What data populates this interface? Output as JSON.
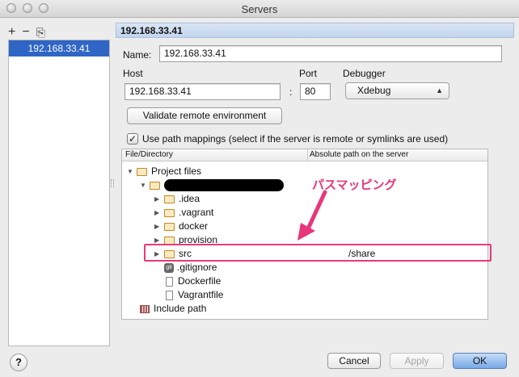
{
  "window": {
    "title": "Servers"
  },
  "left": {
    "toolbar": {
      "add": "+",
      "remove": "−",
      "copy": "⎘"
    },
    "servers": [
      "192.168.33.41"
    ]
  },
  "server": {
    "header": "192.168.33.41",
    "name_label": "Name:",
    "name_value": "192.168.33.41",
    "host_label": "Host",
    "host_value": "192.168.33.41",
    "port_label": "Port",
    "port_sep": ":",
    "port_value": "80",
    "debugger_label": "Debugger",
    "debugger_value": "Xdebug",
    "validate_button": "Validate remote environment",
    "use_path_mappings": "Use path mappings (select if the server is remote or symlinks are used)",
    "use_path_mappings_checked": true
  },
  "tree": {
    "col_file": "File/Directory",
    "col_path": "Absolute path on the server",
    "project_files": "Project files",
    "children": [
      ".idea",
      ".vagrant",
      "docker",
      "provision",
      "src"
    ],
    "src_mapping": "/share",
    "files": [
      ".gitignore",
      "Dockerfile",
      "Vagrantfile"
    ],
    "include_path": "Include path"
  },
  "annotation": {
    "text": "パスマッピング",
    "color": "#e8367a"
  },
  "buttons": {
    "help": "?",
    "cancel": "Cancel",
    "apply": "Apply",
    "ok": "OK"
  }
}
